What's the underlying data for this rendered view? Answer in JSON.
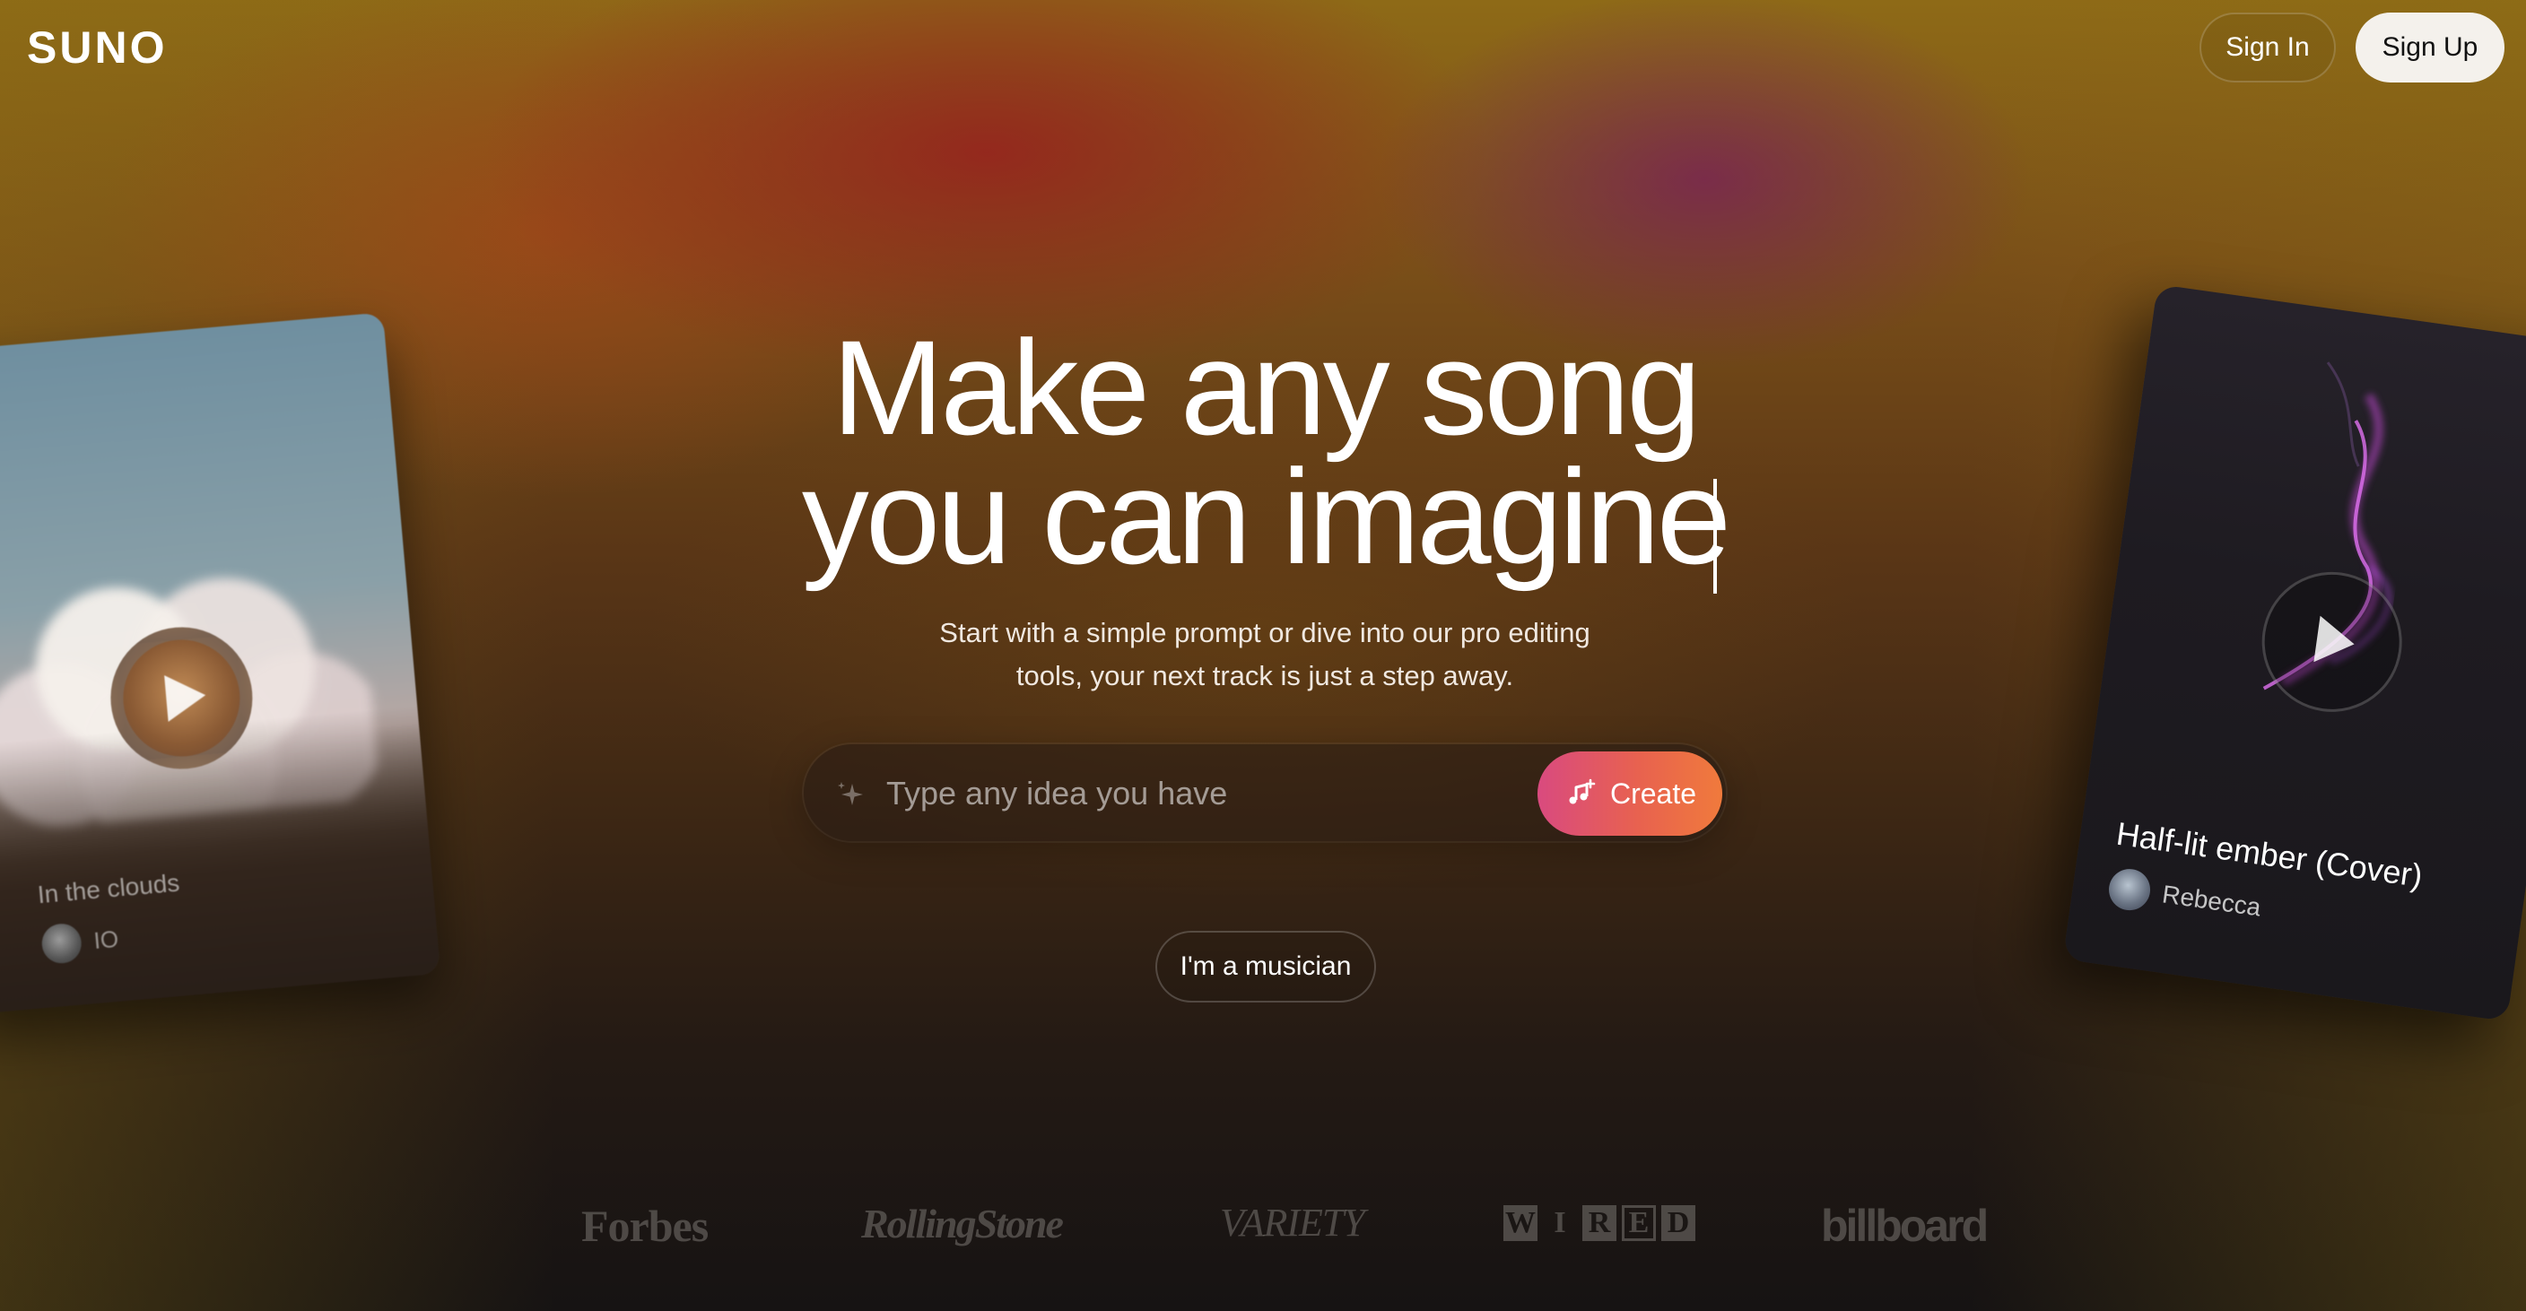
{
  "header": {
    "logo": "SUNO",
    "sign_in_label": "Sign In",
    "sign_up_label": "Sign Up"
  },
  "hero": {
    "title_line1": "Make any song",
    "title_line2": "you can imagine",
    "subtitle_line1": "Start with a simple prompt or dive into our pro editing",
    "subtitle_line2": "tools, your next track is just a step away."
  },
  "prompt": {
    "placeholder": "Type any idea you have",
    "value": "",
    "create_label": "Create"
  },
  "musician_label": "I'm a musician",
  "cards": {
    "left": {
      "title": "In the clouds",
      "user": "IO"
    },
    "right": {
      "title": "Half-lit ember (Cover)",
      "user": "Rebecca"
    }
  },
  "press": {
    "forbes": "Forbes",
    "rolling_stone": "RollingStone",
    "variety": "VARIETY",
    "wired": [
      "W",
      "I",
      "R",
      "E",
      "D"
    ],
    "billboard": "billboard"
  },
  "colors": {
    "create_gradient_start": "#d94a7f",
    "create_gradient_end": "#f07a3c",
    "sign_up_bg": "#f4f1ec"
  },
  "icons": [
    "sparkle-icon",
    "music-note-plus-icon",
    "play-icon",
    "avatar"
  ]
}
